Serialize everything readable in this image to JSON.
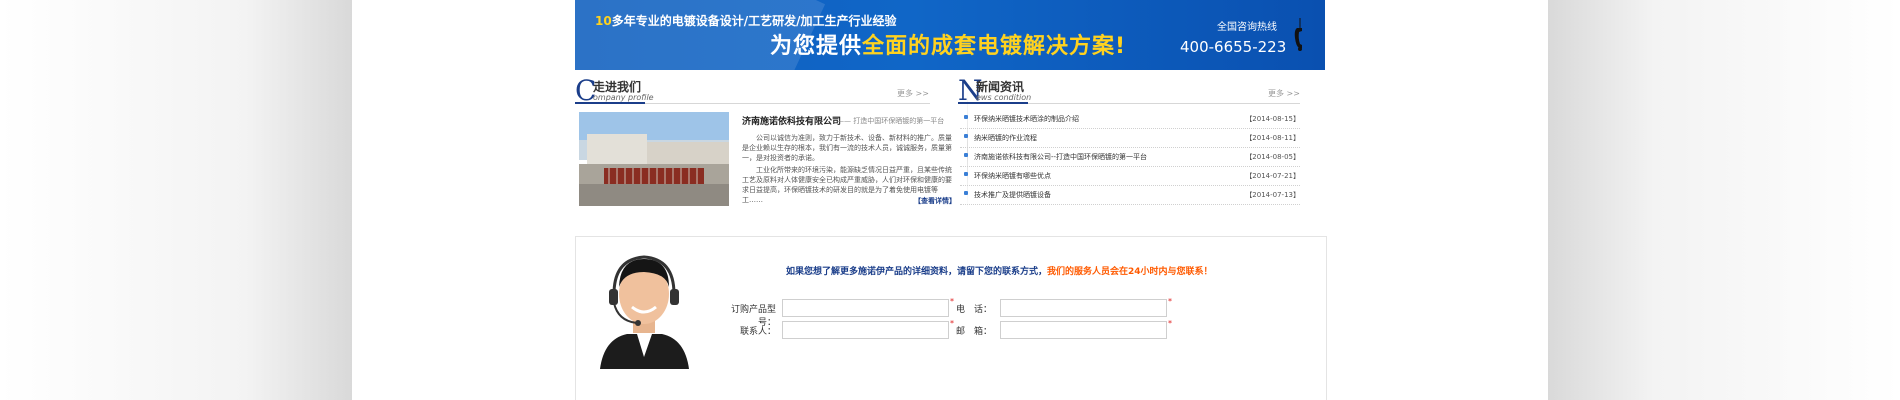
{
  "banner": {
    "slogan_num": "10",
    "slogan_line1_rest": "多年专业的电镀设备设计/工艺研发/加工生产行业经验",
    "slogan2_a": "为您提供",
    "slogan2_b": "全面的成套电镀解决方案!",
    "hotline_label": "全国咨询热线",
    "hotline_number": "400-6655-223"
  },
  "about": {
    "letter": "C",
    "title": "走进我们",
    "subtitle": "ompany profile",
    "more": "更多 >>",
    "company_name": "济南施诺依科技有限公司",
    "company_tag": "—— 打造中国环保晒镀的第一平台",
    "paragraph1": "公司以诚信为准则，致力于新技术、设备、新材料的推广。质量是企业赖以生存的根本，我们有一流的技术人员，诚诚服务，质量第一，是对投资者的承诺。",
    "paragraph2": "工业化所带来的环境污染，能源缺乏情况日益严重，且某些传统工艺及原料对人体健康安全已构成严重威胁，人们对环保和健康的要求日益提高，环保晒镀技术的研发目的就是为了着免使用电镀等工……",
    "detail_link": "【查看详情】"
  },
  "news": {
    "letter": "N",
    "title": "新闻资讯",
    "subtitle": "ews condition",
    "more": "更多 >>",
    "items": [
      {
        "title": "环保纳米晒镀技术晒涂的制品介绍",
        "date": "【2014-08-15】"
      },
      {
        "title": "纳米晒镀的作业流程",
        "date": "【2014-08-11】"
      },
      {
        "title": "济南施诺依科技有限公司--打造中国环保晒镀的第一平台",
        "date": "【2014-08-05】"
      },
      {
        "title": "环保纳米晒镀有哪些优点",
        "date": "【2014-07-21】"
      },
      {
        "title": "技术推广及提供晒镀设备",
        "date": "【2014-07-13】"
      }
    ]
  },
  "contact": {
    "intro_a": "如果您想了解更多施诺伊产品的详细资料，请留下您的联系方式，",
    "intro_b": "我们的服务人员会在24小时内与您联系！",
    "fields": {
      "product_label": "订购产品型号：",
      "phone_label": "电　话：",
      "contact_label": "联系人：",
      "email_label": "邮　箱："
    }
  },
  "colors": {
    "banner_blue": "#1066c7",
    "accent_yellow": "#ffd21f",
    "title_blue": "#1b3e8a",
    "highlight_orange": "#ff5a00"
  }
}
